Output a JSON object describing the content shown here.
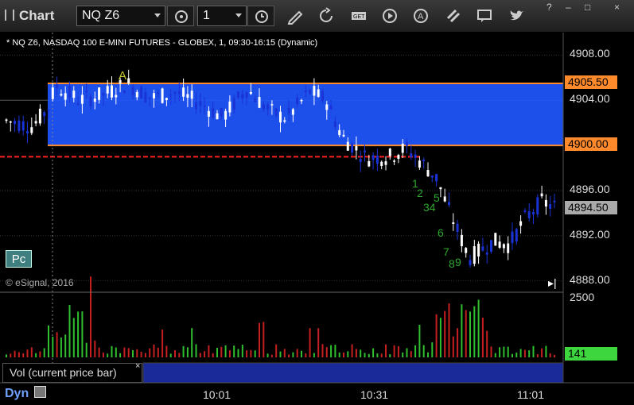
{
  "window": {
    "title": "Chart",
    "symbol": "NQ Z6",
    "interval": "1",
    "controls": [
      "?",
      "–",
      "□",
      "×"
    ]
  },
  "toolbar": {
    "tools": [
      "settings-icon",
      "clock-icon",
      "pencil-icon",
      "refresh-icon",
      "get-icon",
      "play-icon",
      "alert-icon",
      "link-icon",
      "chat-icon",
      "twitter-icon"
    ]
  },
  "chart": {
    "symbol_description": "* NQ Z6, NASDAQ 100 E-MINI FUTURES - GLOBEX, 1, 09:30-16:15 (Dynamic)",
    "copyright": "© eSignal, 2016",
    "pc_label": "Pc",
    "current_price": "4894.50",
    "zone_top": "4905.50",
    "zone_bottom": "4900.00",
    "price_axis": [
      "4908.00",
      "4904.00",
      "4900.00",
      "4896.00",
      "4892.00",
      "4888.00"
    ],
    "time_axis": [
      "10:01",
      "10:31",
      "11:01"
    ],
    "volume_axis_top": "2500",
    "current_volume": "141",
    "volume_title": "Vol (current price bar)",
    "dyn_label": "Dyn",
    "annotation_a": "A",
    "counts": [
      "1",
      "2",
      "34",
      "5",
      "6",
      "7",
      "8",
      "9"
    ],
    "colors": {
      "zone": "#1f56ff",
      "zone_line": "#ff8a2b",
      "up": "#ffffff",
      "down": "#1a33d6",
      "red_line": "#ff2020",
      "vol_up": "#2fbf2f",
      "vol_down": "#c62020",
      "count": "#2ea82e"
    }
  },
  "chart_data": {
    "type": "candlestick",
    "title": "* NQ Z6, NASDAQ 100 E-MINI FUTURES - GLOBEX, 1, 09:30-16:15 (Dynamic)",
    "ylim": [
      4887,
      4910
    ],
    "levels": {
      "zone_top": 4905.5,
      "zone_bottom": 4900,
      "support_red": 4899,
      "last": 4894.5
    },
    "x_ticks": [
      "10:01",
      "10:31",
      "11:01"
    ]
  }
}
